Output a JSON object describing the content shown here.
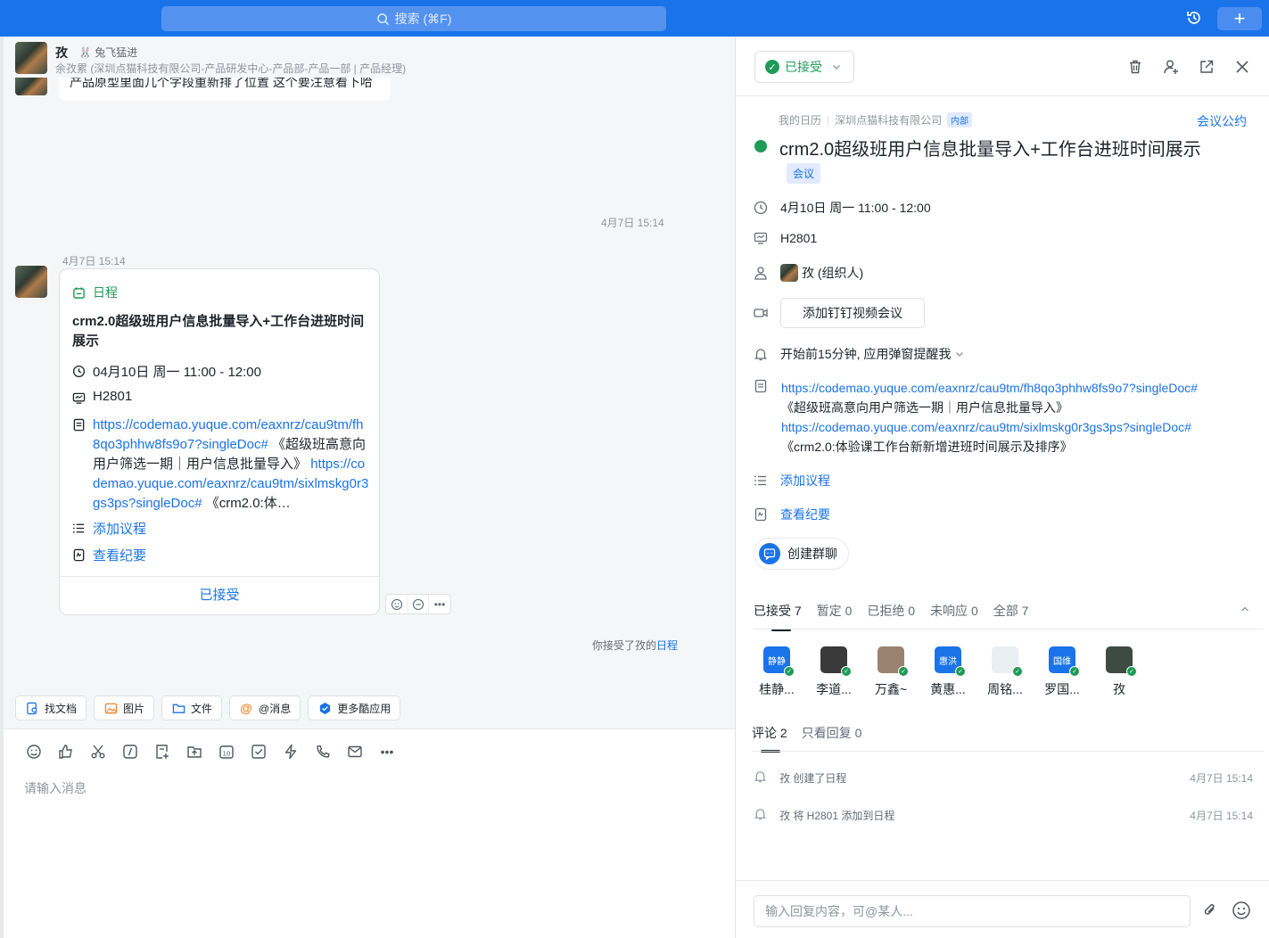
{
  "topbar": {
    "search_placeholder": "搜索 (⌘F)",
    "plus": "+"
  },
  "chat": {
    "name": "孜",
    "status": "🐰 兔飞猛进",
    "subtitle": "余孜累 (深圳点猫科技有限公司-产品研发中心-产品部-产品一部 | 产品经理)",
    "prev_message": "产品原型里面几个字段重新排了位置 这个要注意看下哈",
    "time_right": "4月7日 15:14",
    "time_left": "4月7日 15:14",
    "card": {
      "tag": "日程",
      "title": "crm2.0超级班用户信息批量导入+工作台进班时间展示",
      "time": "04月10日 周一 11:00 - 12:00",
      "room": "H2801",
      "link1": "https://codemao.yuque.com/eaxnrz/cau9tm/fh8qo3phhw8fs9o7?singleDoc#",
      "link1_title": " 《超级班高意向用户筛选一期｜用户信息批量导入》",
      "link2": "https://codemao.yuque.com/eaxnrz/cau9tm/sixlmskg0r3gs3ps?singleDoc#",
      "link2_title": " 《crm2.0:体…",
      "agenda": "添加议程",
      "minutes": "查看纪要",
      "footer": "已接受"
    },
    "accepted_note": "你接受了孜的",
    "accepted_link": "日程",
    "quick": [
      "找文档",
      "图片",
      "文件",
      "@消息",
      "更多酷应用"
    ],
    "composer_placeholder": "请输入消息"
  },
  "panel": {
    "status": "已接受",
    "crumb_cal": "我的日历",
    "crumb_org": "深圳点猫科技有限公司",
    "crumb_badge": "内部",
    "rules": "会议公约",
    "title": "crm2.0超级班用户信息批量导入+工作台进班时间展示",
    "tag": "会议",
    "time": "4月10日 周一 11:00 - 12:00",
    "room": "H2801",
    "organizer": "孜 (组织人)",
    "video_btn": "添加钉钉视频会议",
    "reminder": "开始前15分钟, 应用弹窗提醒我",
    "link1": "https://codemao.yuque.com/eaxnrz/cau9tm/fh8qo3phhw8fs9o7?singleDoc#",
    "link1_title": "《超级班高意向用户筛选一期｜用户信息批量导入》",
    "link2": "https://codemao.yuque.com/eaxnrz/cau9tm/sixlmskg0r3gs3ps?singleDoc#",
    "link2_title": "《crm2.0:体验课工作台新新增进班时间展示及排序》",
    "agenda": "添加议程",
    "minutes": "查看纪要",
    "group_chat": "创建群聊",
    "tabs": [
      "已接受 7",
      "暂定 0",
      "已拒绝 0",
      "未响应 0",
      "全部 7"
    ],
    "attendees": [
      {
        "name": "桂静...",
        "badge": "静静",
        "color": "#1a73e8"
      },
      {
        "name": "李道...",
        "badge": "",
        "color": "#3a3a3a"
      },
      {
        "name": "万鑫~",
        "badge": "",
        "color": "#9a8270"
      },
      {
        "name": "黄惠...",
        "badge": "惠洪",
        "color": "#1a73e8"
      },
      {
        "name": "周铭...",
        "badge": "",
        "color": "#e9eef2"
      },
      {
        "name": "罗国...",
        "badge": "国维",
        "color": "#1a73e8"
      },
      {
        "name": "孜",
        "badge": "",
        "color": "#3d4b42"
      }
    ],
    "comment_tabs": [
      "评论 2",
      "只看回复 0"
    ],
    "logs": [
      {
        "text": "孜 创建了日程",
        "time": "4月7日 15:14"
      },
      {
        "text": "孜 将 H2801 添加到日程",
        "time": "4月7日 15:14"
      }
    ],
    "reply_placeholder": "输入回复内容，可@某人..."
  }
}
